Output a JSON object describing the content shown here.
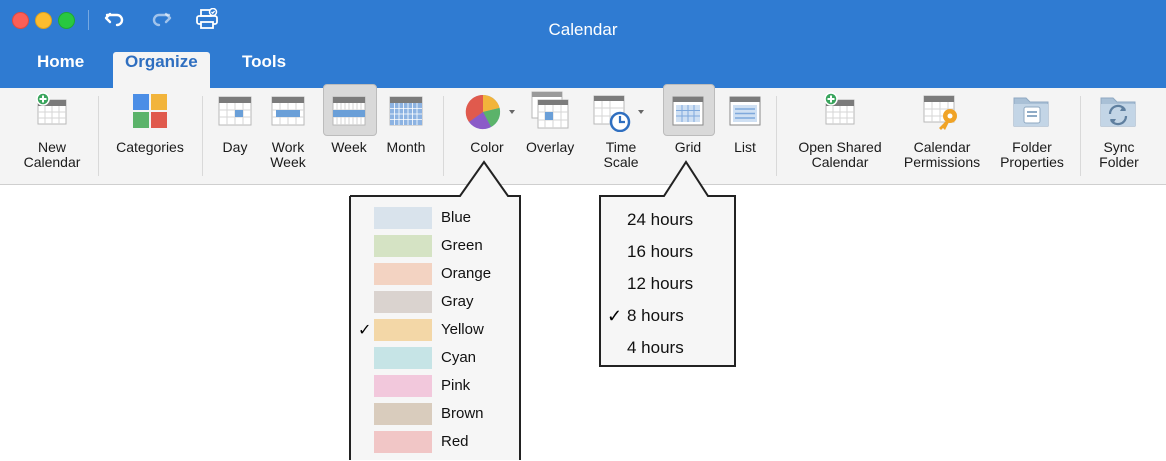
{
  "window": {
    "title": "Calendar"
  },
  "tabs": [
    {
      "label": "Home",
      "active": false
    },
    {
      "label": "Organize",
      "active": true
    },
    {
      "label": "Tools",
      "active": false
    }
  ],
  "ribbon": {
    "new_calendar": "New\nCalendar",
    "categories": "Categories",
    "day": "Day",
    "work_week": "Work\nWeek",
    "week": "Week",
    "month": "Month",
    "color": "Color",
    "overlay": "Overlay",
    "time_scale": "Time\nScale",
    "grid": "Grid",
    "list": "List",
    "open_shared_calendar": "Open Shared\nCalendar",
    "calendar_permissions": "Calendar\nPermissions",
    "folder_properties": "Folder\nProperties",
    "sync_folder": "Sync\nFolder"
  },
  "color_menu": {
    "items": [
      {
        "label": "Blue",
        "color": "#d9e3ec",
        "checked": false
      },
      {
        "label": "Green",
        "color": "#d5e3c4",
        "checked": false
      },
      {
        "label": "Orange",
        "color": "#f3d3c2",
        "checked": false
      },
      {
        "label": "Gray",
        "color": "#dad3cf",
        "checked": false
      },
      {
        "label": "Yellow",
        "color": "#f3d7a7",
        "checked": true
      },
      {
        "label": "Cyan",
        "color": "#c6e4e6",
        "checked": false
      },
      {
        "label": "Pink",
        "color": "#f2c8dc",
        "checked": false
      },
      {
        "label": "Brown",
        "color": "#d9ccbd",
        "checked": false
      },
      {
        "label": "Red",
        "color": "#f1c6c6",
        "checked": false
      }
    ]
  },
  "grid_menu": {
    "items": [
      {
        "label": "24 hours",
        "checked": false
      },
      {
        "label": "16 hours",
        "checked": false
      },
      {
        "label": "12 hours",
        "checked": false
      },
      {
        "label": "8 hours",
        "checked": true
      },
      {
        "label": "4 hours",
        "checked": false
      }
    ]
  },
  "check_mark": "✓"
}
